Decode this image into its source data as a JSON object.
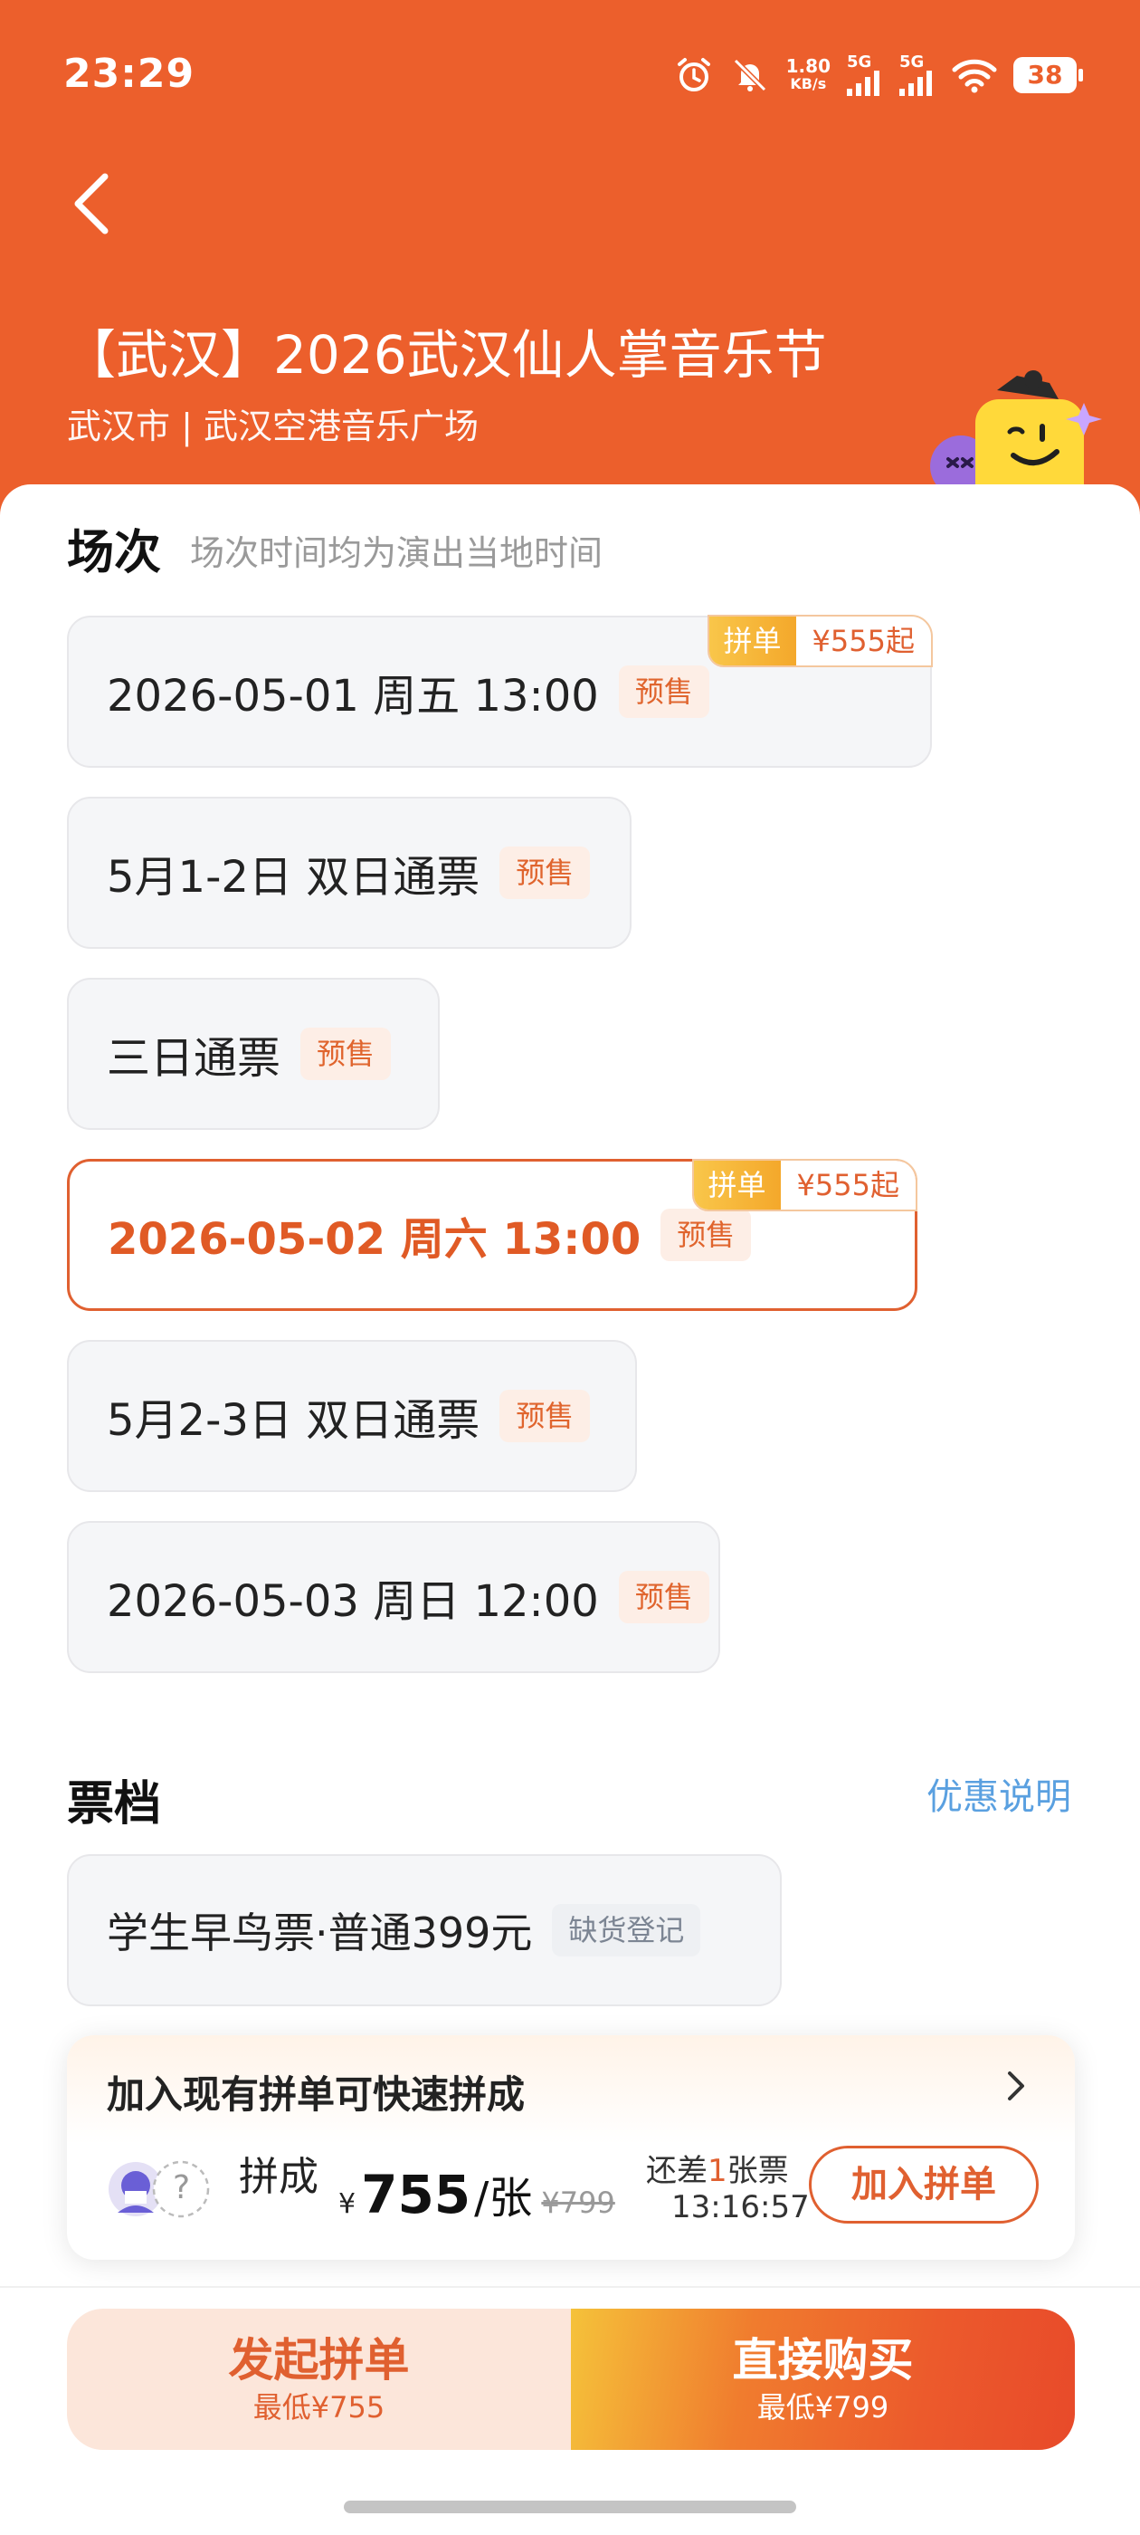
{
  "status_bar": {
    "time": "23:29",
    "net_speed_value": "1.80",
    "net_speed_unit": "KB/s",
    "signal1_label": "5G",
    "signal2_label": "5G",
    "battery": "38"
  },
  "header": {
    "title": "【武汉】2026武汉仙人掌音乐节",
    "venue": "武汉市 | 武汉空港音乐广场",
    "accent_color": "#ec5f2c"
  },
  "sessions_section": {
    "title": "场次",
    "subtitle": "场次时间均为演出当地时间",
    "items": [
      {
        "label": "2026-05-01  周五 13:00",
        "tag": "预售",
        "badge_left": "拼单",
        "badge_right": "¥555起",
        "selected": false
      },
      {
        "label": "5月1-2日 双日通票",
        "tag": "预售",
        "selected": false
      },
      {
        "label": "三日通票",
        "tag": "预售",
        "selected": false
      },
      {
        "label": "2026-05-02 周六 13:00",
        "tag": "预售",
        "badge_left": "拼单",
        "badge_right": "¥555起",
        "selected": true
      },
      {
        "label": "5月2-3日 双日通票",
        "tag": "预售",
        "selected": false
      },
      {
        "label": "2026-05-03 周日 12:00",
        "tag": "预售",
        "selected": false
      }
    ]
  },
  "tickets_section": {
    "title": "票档",
    "discount_link": "优惠说明",
    "items": [
      {
        "label": "学生早鸟票·普通399元",
        "tag": "缺货登记"
      }
    ]
  },
  "group_card": {
    "title": "加入现有拼单可快速拼成",
    "cheng_label": "拼成",
    "currency": "¥",
    "price": "755",
    "unit": "/张",
    "original_price": "¥799",
    "remain_prefix": "还差",
    "remain_count": "1",
    "remain_suffix": "张票",
    "timer": "13:16:57",
    "avatar_placeholder": "?",
    "join_button": "加入拼单"
  },
  "bottom_bar": {
    "left_label": "发起拼单",
    "left_sub": "最低¥755",
    "right_label": "直接购买",
    "right_sub": "最低¥799"
  }
}
